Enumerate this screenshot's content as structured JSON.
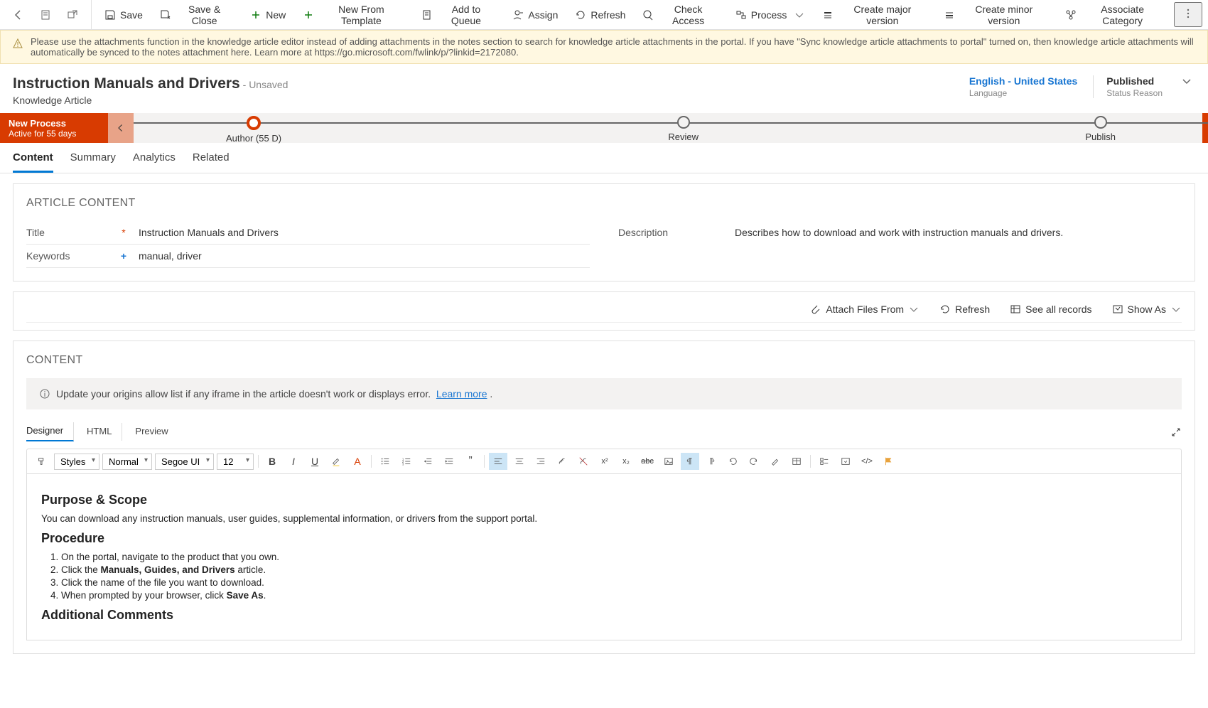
{
  "toolbar": {
    "save": "Save",
    "saveClose": "Save & Close",
    "new": "New",
    "newTemplate": "New From Template",
    "addQueue": "Add to Queue",
    "assign": "Assign",
    "refresh": "Refresh",
    "checkAccess": "Check Access",
    "process": "Process",
    "createMajor": "Create major version",
    "createMinor": "Create minor version",
    "associate": "Associate Category"
  },
  "notif": "Please use the attachments function in the knowledge article editor instead of adding attachments in the notes section to search for knowledge article attachments in the portal. If you have \"Sync knowledge article attachments to portal\" turned on, then knowledge article attachments will automatically be synced to the notes attachment here. Learn more at https://go.microsoft.com/fwlink/p/?linkid=2172080.",
  "header": {
    "title": "Instruction Manuals and Drivers",
    "unsaved": "- Unsaved",
    "subtitle": "Knowledge Article",
    "lang": {
      "value": "English - United States",
      "label": "Language"
    },
    "status": {
      "value": "Published",
      "label": "Status Reason"
    }
  },
  "process": {
    "name": "New Process",
    "active": "Active for 55 days",
    "stages": [
      {
        "label": "Author  (55 D)",
        "active": true
      },
      {
        "label": "Review",
        "active": false
      },
      {
        "label": "Publish",
        "active": false
      }
    ]
  },
  "tabs": [
    "Content",
    "Summary",
    "Analytics",
    "Related"
  ],
  "article": {
    "panelTitle": "ARTICLE CONTENT",
    "titleLabel": "Title",
    "titleVal": "Instruction Manuals and Drivers",
    "keywordsLabel": "Keywords",
    "keywordsVal": "manual, driver",
    "descLabel": "Description",
    "descVal": "Describes how to download and work with instruction manuals and drivers."
  },
  "attach": {
    "attachFrom": "Attach Files From",
    "refresh": "Refresh",
    "seeAll": "See all records",
    "showAs": "Show As"
  },
  "content": {
    "panelTitle": "CONTENT",
    "info": "Update your origins allow list if any iframe in the article doesn't work or displays error.",
    "learnMore": "Learn more",
    "tabs": [
      "Designer",
      "HTML",
      "Preview"
    ],
    "styles": "Styles",
    "format": "Normal",
    "font": "Segoe UI",
    "size": "12",
    "body": {
      "h1": "Purpose & Scope",
      "p1": "You can download any instruction manuals, user guides, supplemental information, or drivers from the support portal.",
      "h2": "Procedure",
      "li1": "On the portal, navigate to the product that you own.",
      "li2a": "Click the ",
      "li2b": "Manuals, Guides, and Drivers",
      "li2c": " article.",
      "li3": "Click the name of the file you want to download.",
      "li4a": "When prompted by your browser, click ",
      "li4b": "Save As",
      "li4c": ".",
      "h3": "Additional Comments"
    }
  }
}
